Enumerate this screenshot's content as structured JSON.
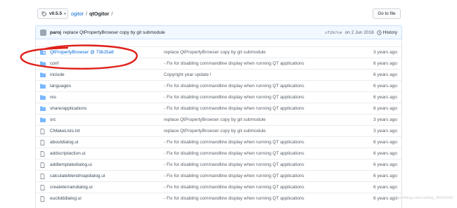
{
  "tag_button": {
    "label": "v0.5.5"
  },
  "breadcrumb": {
    "repo": "ogitor",
    "sep1": "/",
    "current": "qtOgitor",
    "sep2": "/"
  },
  "goto_file": {
    "label": "Go to file"
  },
  "latest_commit": {
    "author": "paroj",
    "message": "replace QtPropertyBrowser copy by git submodule",
    "sha": "cf2b7ce",
    "date": "on 2 Jun 2018",
    "history_label": "History"
  },
  "files": [
    {
      "type": "submodule",
      "name": "QtPropertyBrowser @ 73b15a8",
      "message": "replace QtPropertyBrowser copy by git submodule",
      "age": "3 years ago"
    },
    {
      "type": "folder",
      "name": "conf",
      "message": "- Fix for disabling commandline display when running QT applications",
      "age": "6 years ago"
    },
    {
      "type": "folder",
      "name": "include",
      "message": "Copyright year update !",
      "age": "6 years ago"
    },
    {
      "type": "folder",
      "name": "languages",
      "message": "- Fix for disabling commandline display when running QT applications",
      "age": "6 years ago"
    },
    {
      "type": "folder",
      "name": "res",
      "message": "- Fix for disabling commandline display when running QT applications",
      "age": "6 years ago"
    },
    {
      "type": "folder",
      "name": "share/applications",
      "message": "- Fix for disabling commandline display when running QT applications",
      "age": "6 years ago"
    },
    {
      "type": "folder",
      "name": "src",
      "message": "replace QtPropertyBrowser copy by git submodule",
      "age": "3 years ago"
    },
    {
      "type": "file",
      "name": "CMakeLists.txt",
      "message": "replace QtPropertyBrowser copy by git submodule",
      "age": "3 years ago"
    },
    {
      "type": "file",
      "name": "aboutdialog.ui",
      "message": "- Fix for disabling commandline display when running QT applications",
      "age": "6 years ago"
    },
    {
      "type": "file",
      "name": "addscriptaction.ui",
      "message": "- Fix for disabling commandline display when running QT applications",
      "age": "6 years ago"
    },
    {
      "type": "file",
      "name": "addtemplatedialog.ui",
      "message": "- Fix for disabling commandline display when running QT applications",
      "age": "6 years ago"
    },
    {
      "type": "file",
      "name": "calculateblendmapdialog.ui",
      "message": "- Fix for disabling commandline display when running QT applications",
      "age": "6 years ago"
    },
    {
      "type": "file",
      "name": "createterraindialog.ui",
      "message": "- Fix for disabling commandline display when running QT applications",
      "age": "6 years ago"
    },
    {
      "type": "file",
      "name": "euclidddialog.ui",
      "message": "- Fix for disabling commandline display when running QT applications",
      "age": "6 years ago"
    }
  ],
  "watermark": "https://blog.csdn.net/qq_38324243",
  "colors": {
    "link": "#0366d6",
    "folder": "#79b8ff",
    "annotation": "#e0201a"
  }
}
